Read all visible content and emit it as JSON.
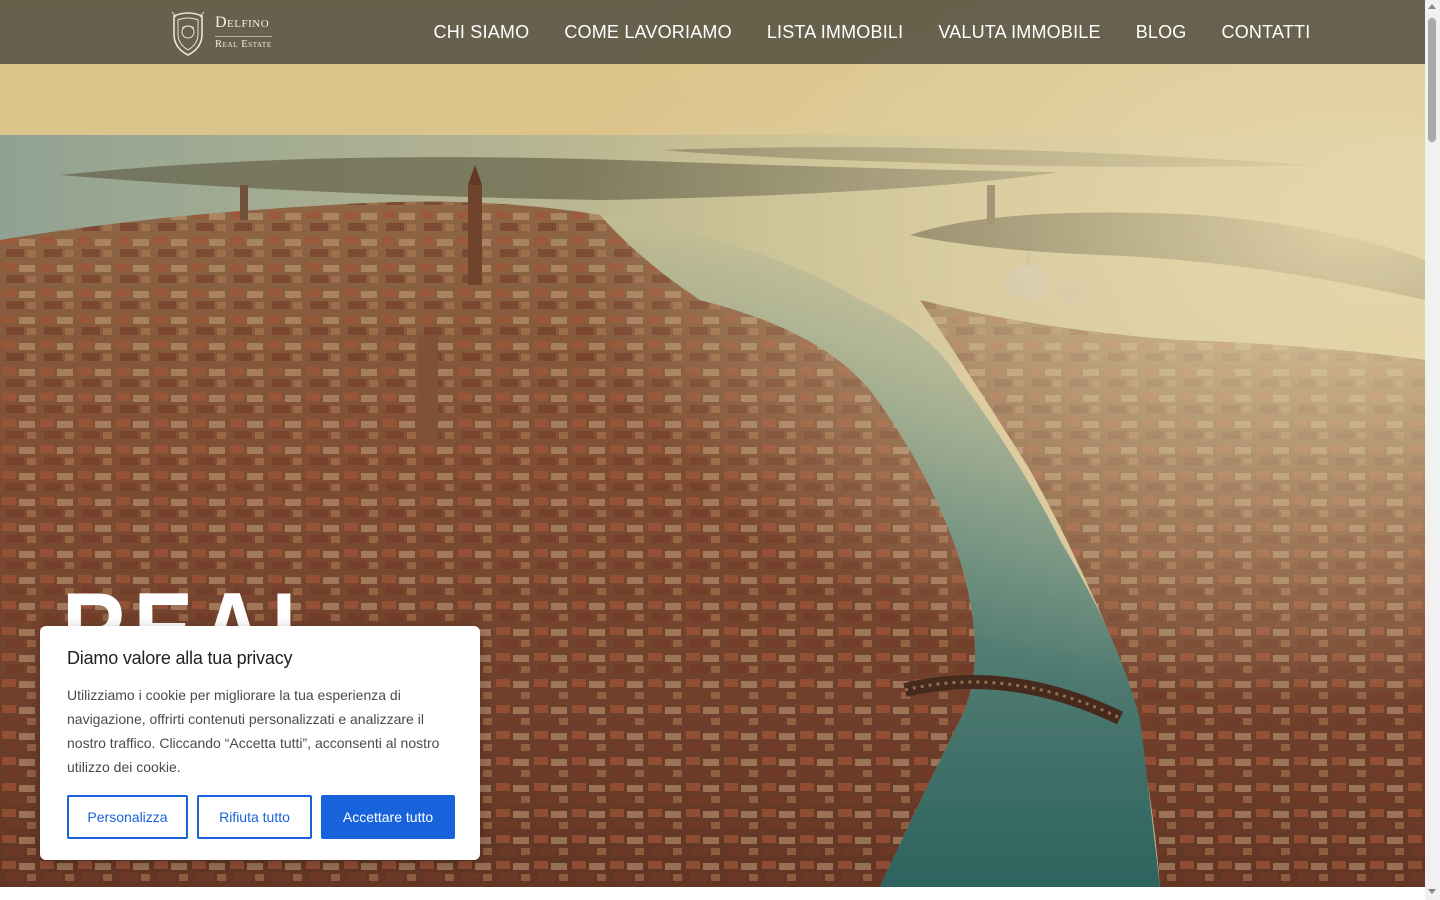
{
  "brand": {
    "name": "Delfino",
    "tagline": "Real Estate"
  },
  "nav": {
    "items": [
      {
        "label": "CHI SIAMO"
      },
      {
        "label": "COME LAVORIAMO"
      },
      {
        "label": "LISTA IMMOBILI"
      },
      {
        "label": "VALUTA IMMOBILE"
      },
      {
        "label": "BLOG"
      },
      {
        "label": "CONTATTI"
      }
    ]
  },
  "hero": {
    "headline": "REAL"
  },
  "cookie_banner": {
    "title": "Diamo valore alla tua privacy",
    "text": "Utilizziamo i cookie per migliorare la tua esperienza di navigazione, offrirti contenuti personalizzati e analizzare il nostro traffico. Cliccando “Accetta tutti”, acconsenti al nostro utilizzo dei cookie.",
    "customize_label": "Personalizza",
    "reject_label": "Rifiuta tutto",
    "accept_label": "Accettare tutto"
  },
  "colors": {
    "header_bg": "#5c5846",
    "accent_blue": "#1863dc"
  }
}
